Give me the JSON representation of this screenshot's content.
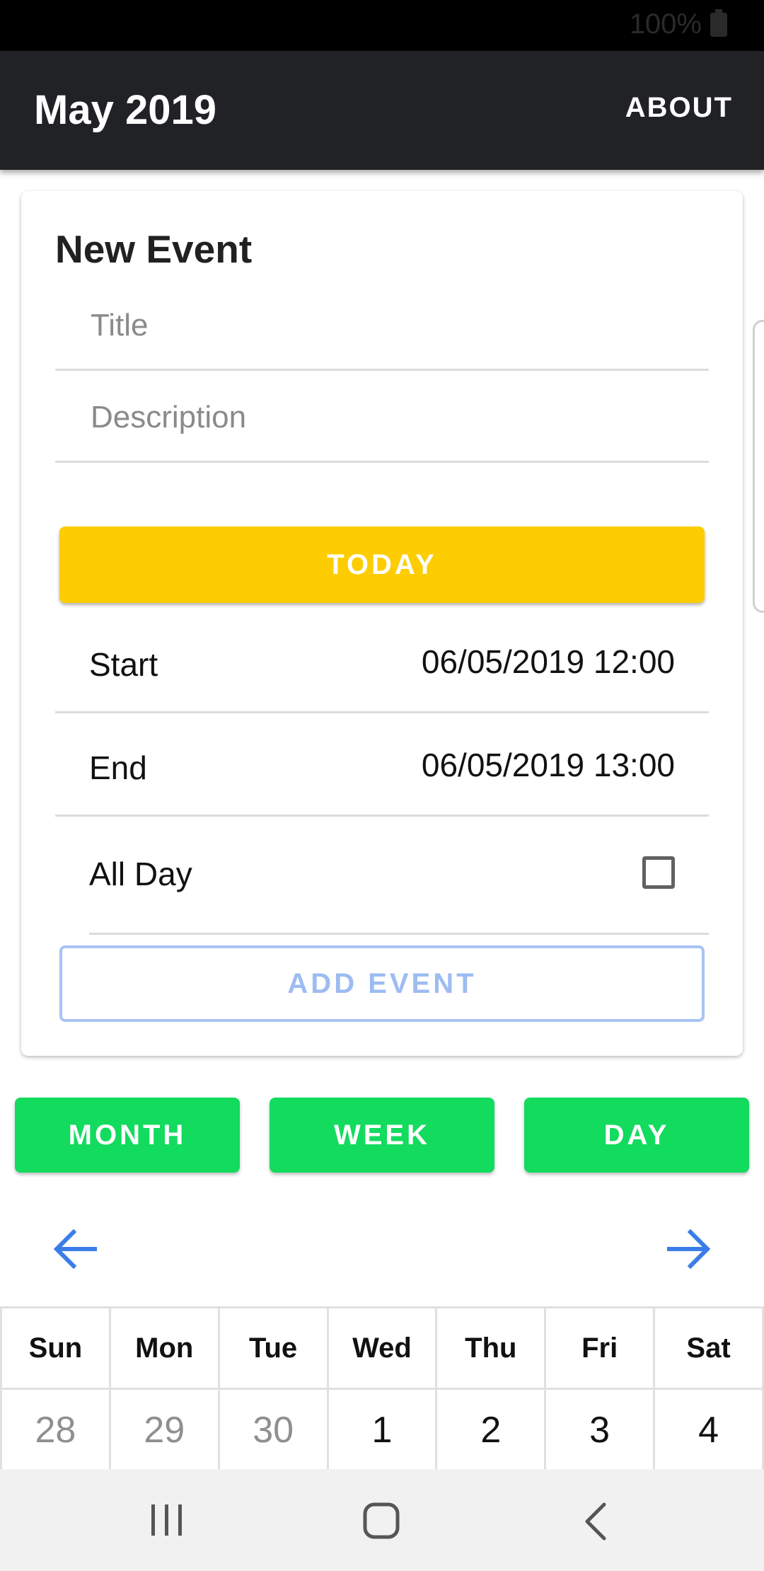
{
  "status_bar": {
    "battery": "100%"
  },
  "app_bar": {
    "title": "May 2019",
    "about_label": "ABOUT"
  },
  "form": {
    "heading": "New Event",
    "title_placeholder": "Title",
    "title_value": "",
    "description_placeholder": "Description",
    "description_value": "",
    "today_label": "TODAY",
    "start_label": "Start",
    "start_value": "06/05/2019 12:00",
    "end_label": "End",
    "end_value": "06/05/2019 13:00",
    "all_day_label": "All Day",
    "all_day_checked": false,
    "add_event_label": "ADD EVENT"
  },
  "view_buttons": {
    "month": "MONTH",
    "week": "WEEK",
    "day": "DAY"
  },
  "calendar": {
    "weekdays": [
      "Sun",
      "Mon",
      "Tue",
      "Wed",
      "Thu",
      "Fri",
      "Sat"
    ],
    "week1": [
      "28",
      "29",
      "30",
      "1",
      "2",
      "3",
      "4"
    ]
  },
  "icons": {
    "prev": "arrow-left-icon",
    "next": "arrow-right-icon",
    "recents": "recent-apps-icon",
    "home": "home-icon",
    "back": "back-icon"
  },
  "colors": {
    "app_bar": "#212225",
    "today_button": "#fdcc01",
    "view_button": "#12db5e",
    "accent_blue": "#3b7de8",
    "add_event_border": "#a8c4f5"
  }
}
